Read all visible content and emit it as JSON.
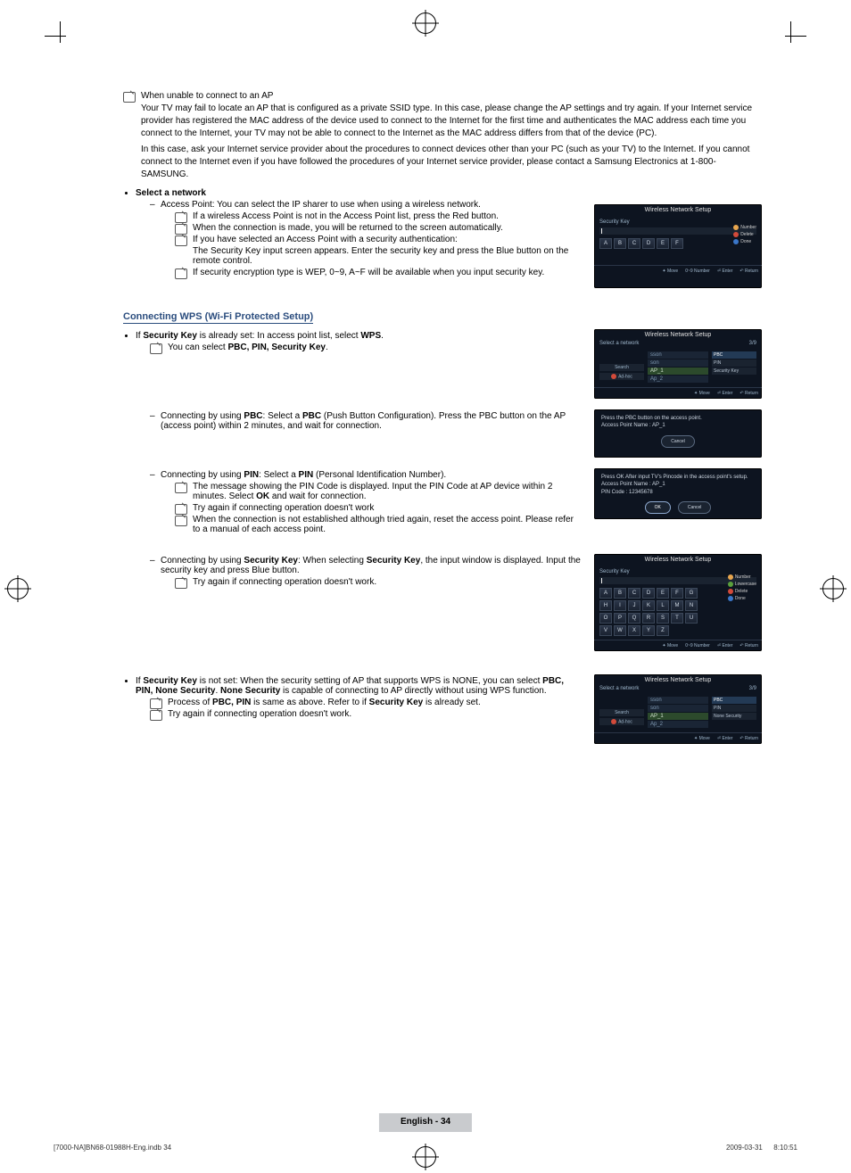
{
  "intro": {
    "heading": "When unable to connect to an AP",
    "p1": "Your TV may fail to locate an AP that is configured as a private SSID type. In this case, please change the AP settings and try again. If your Internet service provider has registered the MAC address of the device used to connect to the Internet for the first time and authenticates the MAC address each time you connect to the Internet, your TV may not be able to connect to the Internet as the MAC address differs from that of the device (PC).",
    "p2": "In this case, ask your Internet service provider about the procedures to connect devices other than your PC (such as your TV) to the Internet. If you cannot connect to the Internet even if you have followed the procedures of your Internet service provider, please contact a Samsung Electronics at 1-800-SAMSUNG."
  },
  "select_network": {
    "heading": "Select a network",
    "ap_line": "Access Point: You can select the IP sharer to use when using a wireless network.",
    "n1": "If a wireless Access Point is not in the Access Point list, press the Red button.",
    "n2": "When the connection is made, you will be returned to the screen automatically.",
    "n3": "If you have selected an Access Point with a security authentication:",
    "n3b": "The Security Key input screen appears. Enter the security key and press the Blue button on the remote control.",
    "n4": "If security encryption type is WEP, 0~9, A~F will be available when you input security key."
  },
  "wps": {
    "heading": "Connecting WPS (Wi-Fi Protected Setup)",
    "line1_pre": "If ",
    "line1_b": "Security Key",
    "line1_post": " is already set: In access point list, select ",
    "line1_b2": "WPS",
    "line1_end": ".",
    "note_select": "You can select ",
    "note_select_b": "PBC, PIN, Security Key",
    "note_select_end": ".",
    "pbc_pre": "Connecting by using ",
    "pbc_b1": "PBC",
    "pbc_mid": ": Select a ",
    "pbc_b2": "PBC",
    "pbc_post": " (Push Button Configuration). Press the PBC button on the AP (access point) within 2 minutes, and wait for connection.",
    "pin_pre": "Connecting by using ",
    "pin_b": "PIN",
    "pin_mid": ": Select a ",
    "pin_b2": "PIN",
    "pin_post": " (Personal Identification Number).",
    "pin_n1a": "The message showing the PIN Code is displayed. Input the PIN Code at AP device within 2 minutes. Select ",
    "pin_n1b": "OK",
    "pin_n1c": " and wait for connection.",
    "pin_n2": "Try again if connecting operation doesn't work",
    "pin_n3": "When the connection is not established although tried again, reset the access point. Please refer to a manual of each access point.",
    "sk_pre": "Connecting by using ",
    "sk_b1": "Security Key",
    "sk_mid": ": When selecting ",
    "sk_b2": "Security Key",
    "sk_post": ", the input window is displayed. Input the security key and press Blue button.",
    "sk_n1": "Try again if connecting operation doesn't work.",
    "notset_pre": "If ",
    "notset_b": "Security Key",
    "notset_mid": " is not set: When the security setting of AP that supports WPS is NONE, you can select ",
    "notset_b2": "PBC, PIN, None Security",
    "notset_mid2": ". ",
    "notset_b3": "None Security",
    "notset_post": " is capable of connecting to AP directly without using WPS function.",
    "notset_n1a": "Process of ",
    "notset_n1b": "PBC, PIN",
    "notset_n1c": " is same as above. Refer to if ",
    "notset_n1d": "Security Key",
    "notset_n1e": " is already set.",
    "notset_n2": "Try again if connecting operation doesn't work."
  },
  "shot_a": {
    "title": "Wireless Network Setup",
    "label": "Security Key",
    "keys_r1": [
      "A",
      "B",
      "C",
      "D",
      "E",
      "F"
    ],
    "legend_number": "Number",
    "legend_delete": "Delete",
    "legend_done": "Done",
    "foot_move": "Move",
    "foot_num": "0~9 Number",
    "foot_enter": "Enter",
    "foot_return": "Return"
  },
  "shot_b": {
    "title": "Wireless Network Setup",
    "hdr_left": "Select a network",
    "hdr_right": "3/9",
    "aps": [
      "sson",
      "son",
      "AP_1",
      "Ap_2"
    ],
    "left_search": "Search",
    "left_adhoc": "Ad-hoc",
    "opts": [
      "PBC",
      "PIN",
      "Security Key"
    ],
    "foot_move": "Move",
    "foot_enter": "Enter",
    "foot_return": "Return"
  },
  "shot_c": {
    "line1": "Press the PBC button on the access point.",
    "line2": "Access Point Name : AP_1",
    "cancel": "Cancel"
  },
  "shot_d": {
    "line1": "Press OK After input TV's Pincode in the access point's setup.",
    "line2": "Access Point Name : AP_1",
    "line3": "PIN Code : 12345678",
    "ok": "OK",
    "cancel": "Cancel"
  },
  "shot_e": {
    "title": "Wireless Network Setup",
    "label": "Security Key",
    "rows": [
      [
        "A",
        "B",
        "C",
        "D",
        "E",
        "F",
        "G"
      ],
      [
        "H",
        "I",
        "J",
        "K",
        "L",
        "M",
        "N"
      ],
      [
        "O",
        "P",
        "Q",
        "R",
        "S",
        "T",
        "U"
      ],
      [
        "V",
        "W",
        "X",
        "Y",
        "Z",
        " ",
        " "
      ]
    ],
    "legend_number": "Number",
    "legend_lower": "Lowercase",
    "legend_delete": "Delete",
    "legend_done": "Done",
    "foot_move": "Move",
    "foot_num": "0~9 Number",
    "foot_enter": "Enter",
    "foot_return": "Return"
  },
  "shot_f": {
    "title": "Wireless Network Setup",
    "hdr_left": "Select a network",
    "hdr_right": "3/9",
    "aps": [
      "sson",
      "son",
      "AP_1",
      "Ap_2"
    ],
    "left_search": "Search",
    "left_adhoc": "Ad-hoc",
    "opts": [
      "PBC",
      "PIN",
      "None Security"
    ],
    "foot_move": "Move",
    "foot_enter": "Enter",
    "foot_return": "Return"
  },
  "footer": {
    "pagenum": "English - 34",
    "left": "[7000-NA]BN68-01988H-Eng.indb   34",
    "right": "2009-03-31      8:10:51"
  }
}
